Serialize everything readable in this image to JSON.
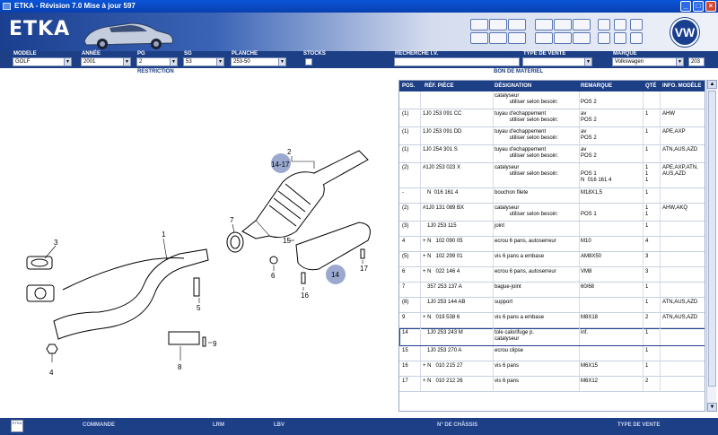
{
  "window": {
    "title": "ETKA - Révision 7.0 Mise à jour 597"
  },
  "header": {
    "logo": "ETKA",
    "brand_logo_text": "VW"
  },
  "filters": {
    "modele": {
      "label": "MODELE",
      "value": "GOLF"
    },
    "annee": {
      "label": "ANNÉE",
      "value": "2001"
    },
    "pg": {
      "label": "PG",
      "value": "2"
    },
    "sg": {
      "label": "SG",
      "value": "53"
    },
    "planche": {
      "label": "PLANCHE",
      "value": "253-50"
    },
    "stocks": {
      "label": "STOCKS"
    },
    "recherche": {
      "label": "RECHERCHE I.V.",
      "value": ""
    },
    "type_vente": {
      "label": "TYPE DE VENTE",
      "value": ""
    },
    "marque": {
      "label": "MARQUE",
      "value": "Volkswagen",
      "code": "203"
    }
  },
  "subheader": {
    "left": "RESTRICTION",
    "right": "BON DE MATÉRIEL"
  },
  "table": {
    "headers": [
      "POS.",
      "RÉF. PIÈCE",
      "DÉSIGNATION",
      "REMARQUE",
      "QTÉ",
      "INFO. MODÈLE"
    ],
    "rows": [
      {
        "pos": "",
        "ref": "",
        "des": "catalyseur\n          utiliser selon besoin:",
        "rem": "\nPOS 2",
        "qte": "",
        "info": ""
      },
      {
        "pos": "(1)",
        "ref": "1J0 253 091 CC",
        "des": "tuyau d'echappement\n          utiliser selon besoin:",
        "rem": "av\nPOS 2",
        "qte": "1",
        "info": "AHW"
      },
      {
        "pos": "(1)",
        "ref": "1J0 253 091 DD",
        "des": "tuyau d'echappement\n          utiliser selon besoin:",
        "rem": "av\nPOS 2",
        "qte": "1",
        "info": "APE,AXP"
      },
      {
        "pos": "(1)",
        "ref": "1J0 254 301 S",
        "des": "tuyau d'echappement\n          utiliser selon besoin:",
        "rem": "av\nPOS 2",
        "qte": "1",
        "info": "ATN,AUS,AZD"
      },
      {
        "pos": "(2)",
        "ref": "#1J0 253 023 X",
        "des": "catalyseur\n          utiliser selon besoin:",
        "rem": "\nPOS 1\nN  016 161 4",
        "qte": "1\n1\n1",
        "info": "APE,AXP,ATN,\nAUS,AZD"
      },
      {
        "pos": "-",
        "ref": "   N  016 161 4",
        "des": "bouchon filete",
        "rem": "M18X1,5",
        "qte": "1",
        "info": ""
      },
      {
        "pos": "(2)",
        "ref": "#1J0 131 089 BX",
        "des": "catalyseur\n          utiliser selon besoin:",
        "rem": "\nPOS 1",
        "qte": "1\n1",
        "info": "AHW,AKQ"
      },
      {
        "pos": "(3)",
        "ref": "   1J0 253 115",
        "des": "joint",
        "rem": "",
        "qte": "1",
        "info": ""
      },
      {
        "pos": "4",
        "ref": "+ N   102 090 05",
        "des": "ecrou 6 pans, autoserreur",
        "rem": "M10",
        "qte": "4",
        "info": ""
      },
      {
        "pos": "(5)",
        "ref": "+ N   102 299 01",
        "des": "vis 6 pans a embase",
        "rem": "AM8X50",
        "qte": "3",
        "info": ""
      },
      {
        "pos": "6",
        "ref": "+ N   022 146 4",
        "des": "ecrou 6 pans, autoserreur",
        "rem": "VM8",
        "qte": "3",
        "info": ""
      },
      {
        "pos": "7",
        "ref": "   357 253 137 A",
        "des": "bague-joint",
        "rem": "60/68",
        "qte": "1",
        "info": ""
      },
      {
        "pos": "(8)",
        "ref": "   1J0 253 144 AB",
        "des": "support",
        "rem": "",
        "qte": "1",
        "info": "ATN,AUS,AZD"
      },
      {
        "pos": "9",
        "ref": "+ N   019 538 6",
        "des": "vis 6 pans a embase",
        "rem": "M8X18",
        "qte": "2",
        "info": "ATN,AUS,AZD"
      },
      {
        "pos": "14",
        "ref": "   1J0 253 243 M",
        "des": "tole calorifuge p.\ncatalyseur",
        "rem": "inf.",
        "qte": "1",
        "info": ""
      },
      {
        "pos": "15",
        "ref": "   1J0 253 270 A",
        "des": "ecrou clipse",
        "rem": "",
        "qte": "1",
        "info": ""
      },
      {
        "pos": "16",
        "ref": "+ N   010 215 27",
        "des": "vis 6 pans",
        "rem": "M6X15",
        "qte": "1",
        "info": ""
      },
      {
        "pos": "17",
        "ref": "+ N   010 212 26",
        "des": "vis 6 pans",
        "rem": "M6X12",
        "qte": "2",
        "info": ""
      }
    ]
  },
  "diagram": {
    "callouts": [
      "1",
      "2",
      "3",
      "4",
      "5",
      "6",
      "7",
      "8",
      "9",
      "14-17",
      "14",
      "15",
      "16",
      "17"
    ]
  },
  "footer": {
    "logo": "ETKA",
    "commande": "COMMANDE",
    "lrm": "LRM",
    "lbv": "LBV",
    "chassis": "N° DE CHÂSSIS",
    "type_vente": "TYPE DE VENTE"
  }
}
